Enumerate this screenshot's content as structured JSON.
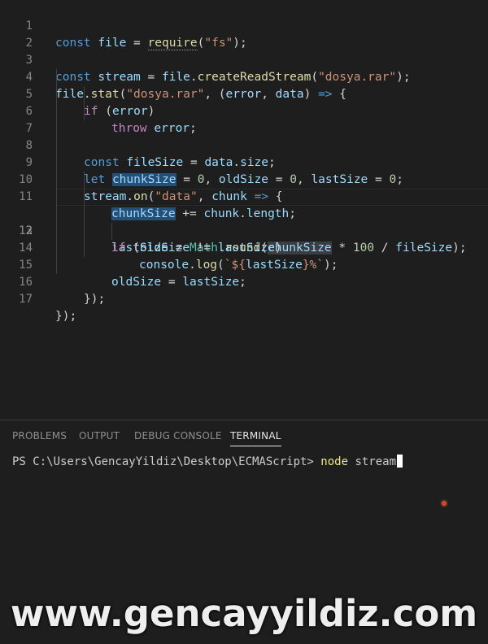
{
  "editor": {
    "line_numbers": [
      "1",
      "2",
      "3",
      "4",
      "5",
      "6",
      "7",
      "8",
      "9",
      "10",
      "11",
      "12",
      "13",
      "14",
      "15",
      "16",
      "17"
    ],
    "active_line": "12",
    "tokens": {
      "l1": [
        "const",
        "file",
        " = ",
        "require",
        "(",
        "\"fs\"",
        ");"
      ],
      "l3": [
        "const",
        "stream",
        " = ",
        "file",
        ".",
        "createReadStream",
        "(",
        "\"dosya.rar\"",
        ");"
      ],
      "l4": [
        "file",
        ".",
        "stat",
        "(",
        "\"dosya.rar\"",
        ", (",
        "error",
        ", ",
        "data",
        ") ",
        "=>",
        " {"
      ],
      "l5": [
        "if",
        " (",
        "error",
        ")"
      ],
      "l6": [
        "throw",
        " ",
        "error",
        ";"
      ],
      "l8": [
        "const",
        "fileSize",
        " = ",
        "data",
        ".",
        "size",
        ";"
      ],
      "l9": [
        "let",
        "chunkSize",
        " = ",
        "0",
        ", ",
        "oldSize",
        " = ",
        "0",
        ", ",
        "lastSize",
        " = ",
        "0",
        ";"
      ],
      "l10": [
        "stream",
        ".",
        "on",
        "(",
        "\"data\"",
        ", ",
        "chunk",
        " ",
        "=>",
        " {"
      ],
      "l11": [
        "chunkSize",
        " += ",
        "chunk",
        ".",
        "length",
        ";"
      ],
      "l12": [
        "lastSize",
        " = ",
        "Math",
        ".",
        "round",
        "(",
        "chunkSize",
        " * ",
        "100",
        " / ",
        "fileSize",
        ");"
      ],
      "l13": [
        "if",
        " (",
        "oldSize",
        " != ",
        "lastSize",
        ")"
      ],
      "l14": [
        "console",
        ".",
        "log",
        "(",
        "`${",
        "lastSize",
        "}%`",
        ");"
      ],
      "l15": [
        "oldSize",
        " = ",
        "lastSize",
        ";"
      ],
      "l16": [
        "});"
      ],
      "l17": [
        "});"
      ]
    }
  },
  "panel": {
    "tabs": [
      "PROBLEMS",
      "OUTPUT",
      "DEBUG CONSOLE",
      "TERMINAL"
    ],
    "active_tab": "TERMINAL",
    "prompt": "PS C:\\Users\\GencayYildiz\\Desktop\\ECMAScript> ",
    "command": "node",
    "argument": " stream"
  },
  "watermark": "www.gencayyildiz.com",
  "colors": {
    "keyword": "#569cd6",
    "control": "#c586c0",
    "function": "#dcdcaa",
    "variable": "#9cdcfe",
    "string": "#ce9178",
    "number": "#b5cea8",
    "selection": "#264f78"
  }
}
